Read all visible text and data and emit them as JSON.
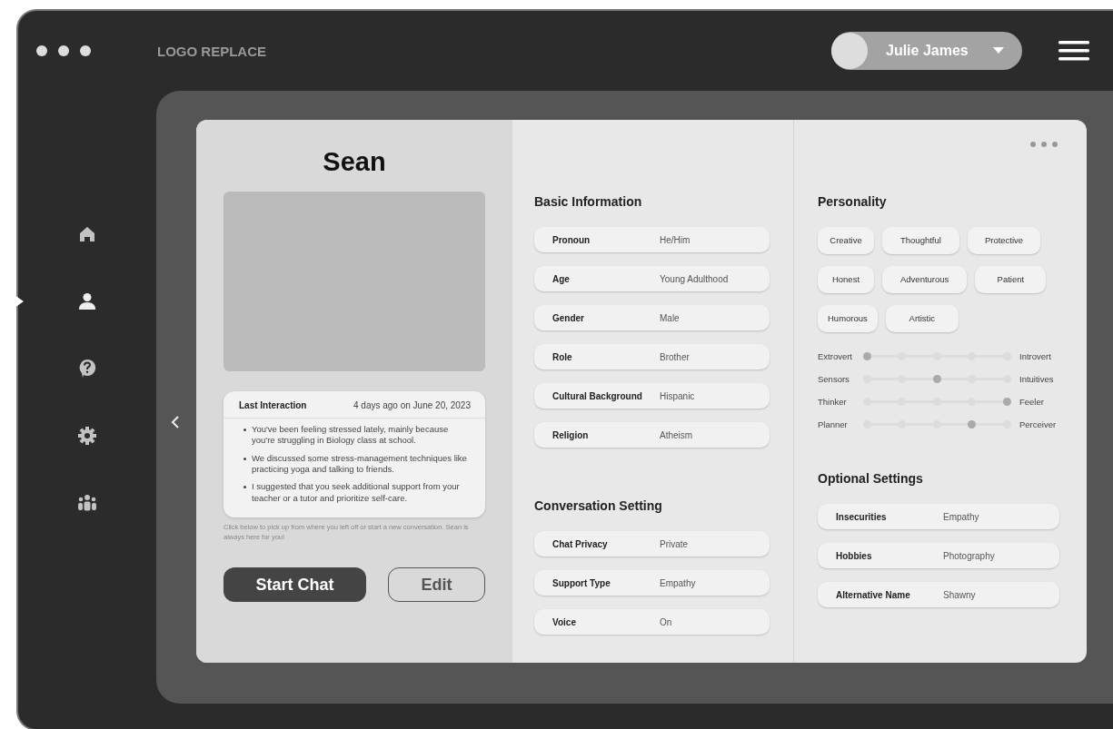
{
  "header": {
    "logo": "LOGO REPLACE",
    "user": {
      "name": "Julie James"
    }
  },
  "nav": [
    {
      "kind": "home",
      "selected": false
    },
    {
      "kind": "person",
      "selected": true
    },
    {
      "kind": "help",
      "selected": false
    },
    {
      "kind": "settings",
      "selected": false
    },
    {
      "kind": "group",
      "selected": false
    }
  ],
  "profile": {
    "name": "Sean",
    "last_interaction": {
      "title": "Last Interaction",
      "time": "4 days ago on June 20, 2023",
      "bullets": [
        "You've been feeling stressed lately, mainly because you're struggling in Biology class at school.",
        "We discussed some stress-management techniques like practicing yoga and talking to friends.",
        "I suggested that you seek additional support from your teacher or a tutor and prioritize self-care."
      ]
    },
    "note": "Click below to pick up from where you left off or start a new conversation. Sean is always here for you!",
    "buttons": [
      {
        "label": "Start Chat",
        "kind": "primary"
      },
      {
        "label": "Edit",
        "kind": "outline"
      }
    ]
  },
  "basic_information": {
    "title": "Basic Information",
    "rows": [
      {
        "label": "Pronoun",
        "value": "He/Him"
      },
      {
        "label": "Age",
        "value": "Young Adulthood"
      },
      {
        "label": "Gender",
        "value": "Male"
      },
      {
        "label": "Role",
        "value": "Brother"
      },
      {
        "label": "Cultural Background",
        "value": "Hispanic"
      },
      {
        "label": "Religion",
        "value": "Atheism"
      }
    ]
  },
  "conversation_setting": {
    "title": "Conversation Setting",
    "rows": [
      {
        "label": "Chat Privacy",
        "value": "Private"
      },
      {
        "label": "Support Type",
        "value": "Empathy"
      },
      {
        "label": "Voice",
        "value": "On"
      }
    ]
  },
  "personality": {
    "title": "Personality",
    "traits": [
      [
        "Creative",
        "Thoughtful",
        "Protective"
      ],
      [
        "Honest",
        "Adventurous",
        "Patient"
      ],
      [
        "Humorous",
        "Artistic"
      ]
    ],
    "scales": [
      {
        "left": "Extrovert",
        "right": "Introvert",
        "level": 0
      },
      {
        "left": "Sensors",
        "right": "Intuitives",
        "level": 0.5
      },
      {
        "left": "Thinker",
        "right": "Feeler",
        "level": 1
      },
      {
        "left": "Planner",
        "right": "Perceiver",
        "level": 0.75
      }
    ]
  },
  "optional_settings": {
    "title": "Optional Settings",
    "rows": [
      {
        "label": "Insecurities",
        "value": "Empathy"
      },
      {
        "label": "Hobbies",
        "value": "Photography"
      },
      {
        "label": "Alternative Name",
        "value": "Shawny"
      }
    ]
  }
}
